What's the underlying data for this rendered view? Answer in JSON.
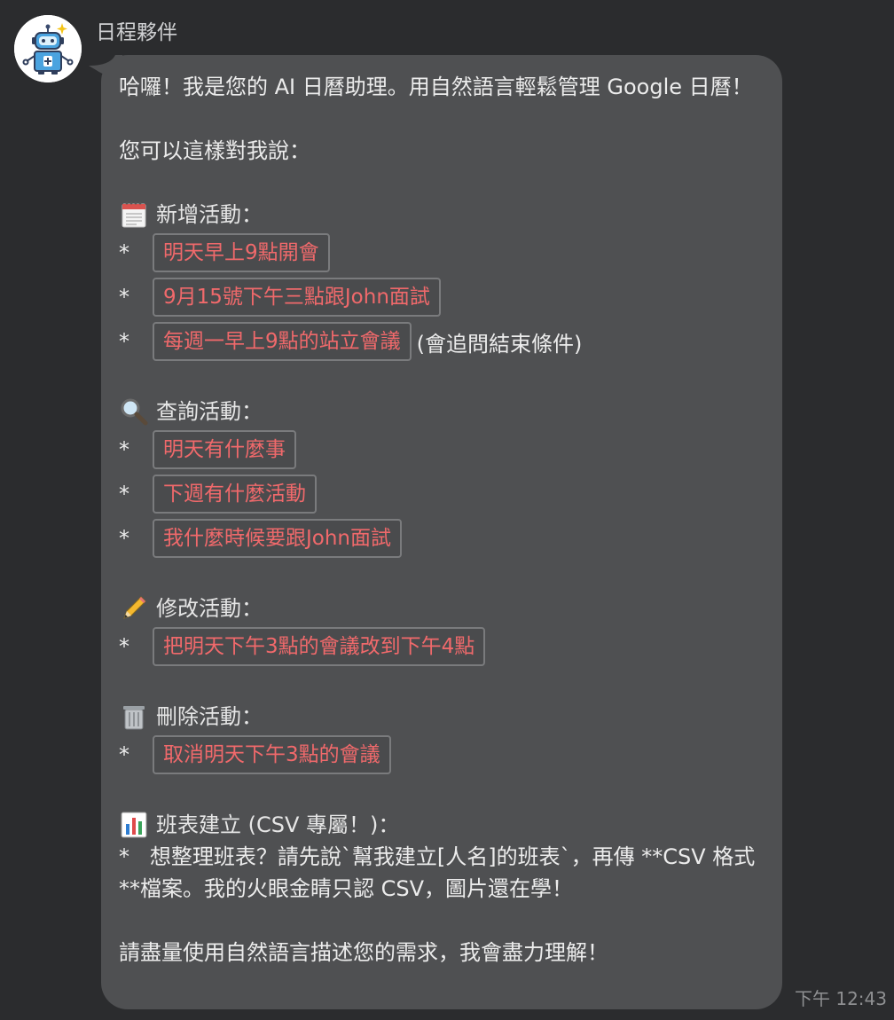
{
  "sender": {
    "name": "日程夥伴"
  },
  "message": {
    "intro": "哈囉！我是您的 AI 日曆助理。用自然語言輕鬆管理 Google 日曆！",
    "prompt": "您可以這樣對我說：",
    "sections": {
      "add": {
        "title": "新增活動：",
        "items": [
          "明天早上9點開會",
          "9月15號下午三點跟John面試",
          "每週一早上9點的站立會議"
        ],
        "note": "(會追問結束條件)"
      },
      "query": {
        "title": "查詢活動：",
        "items": [
          "明天有什麼事",
          "下週有什麼活動",
          "我什麼時候要跟John面試"
        ]
      },
      "edit": {
        "title": "修改活動：",
        "items": [
          "把明天下午3點的會議改到下午4點"
        ]
      },
      "delete": {
        "title": "刪除活動：",
        "items": [
          "取消明天下午3點的會議"
        ]
      },
      "schedule": {
        "title": "班表建立 (CSV 專屬！)：",
        "body": "*   想整理班表？請先說`幫我建立[人名]的班表`，再傳 **CSV 格式**檔案。我的火眼金睛只認 CSV，圖片還在學！"
      }
    },
    "closing": "請盡量使用自然語言描述您的需求，我會盡力理解！",
    "bullet": "*"
  },
  "timestamp": "下午 12:43",
  "icons": {
    "avatar": "robot-avatar-icon",
    "add": "calendar-icon",
    "query": "magnifier-icon",
    "edit": "pencil-icon",
    "delete": "trash-icon",
    "schedule": "bar-chart-icon"
  },
  "colors": {
    "background": "#2b2c2e",
    "bubble": "#4f5052",
    "chip_text": "#f0696b",
    "chip_border": "#7a7b7d",
    "text": "#ececec"
  }
}
